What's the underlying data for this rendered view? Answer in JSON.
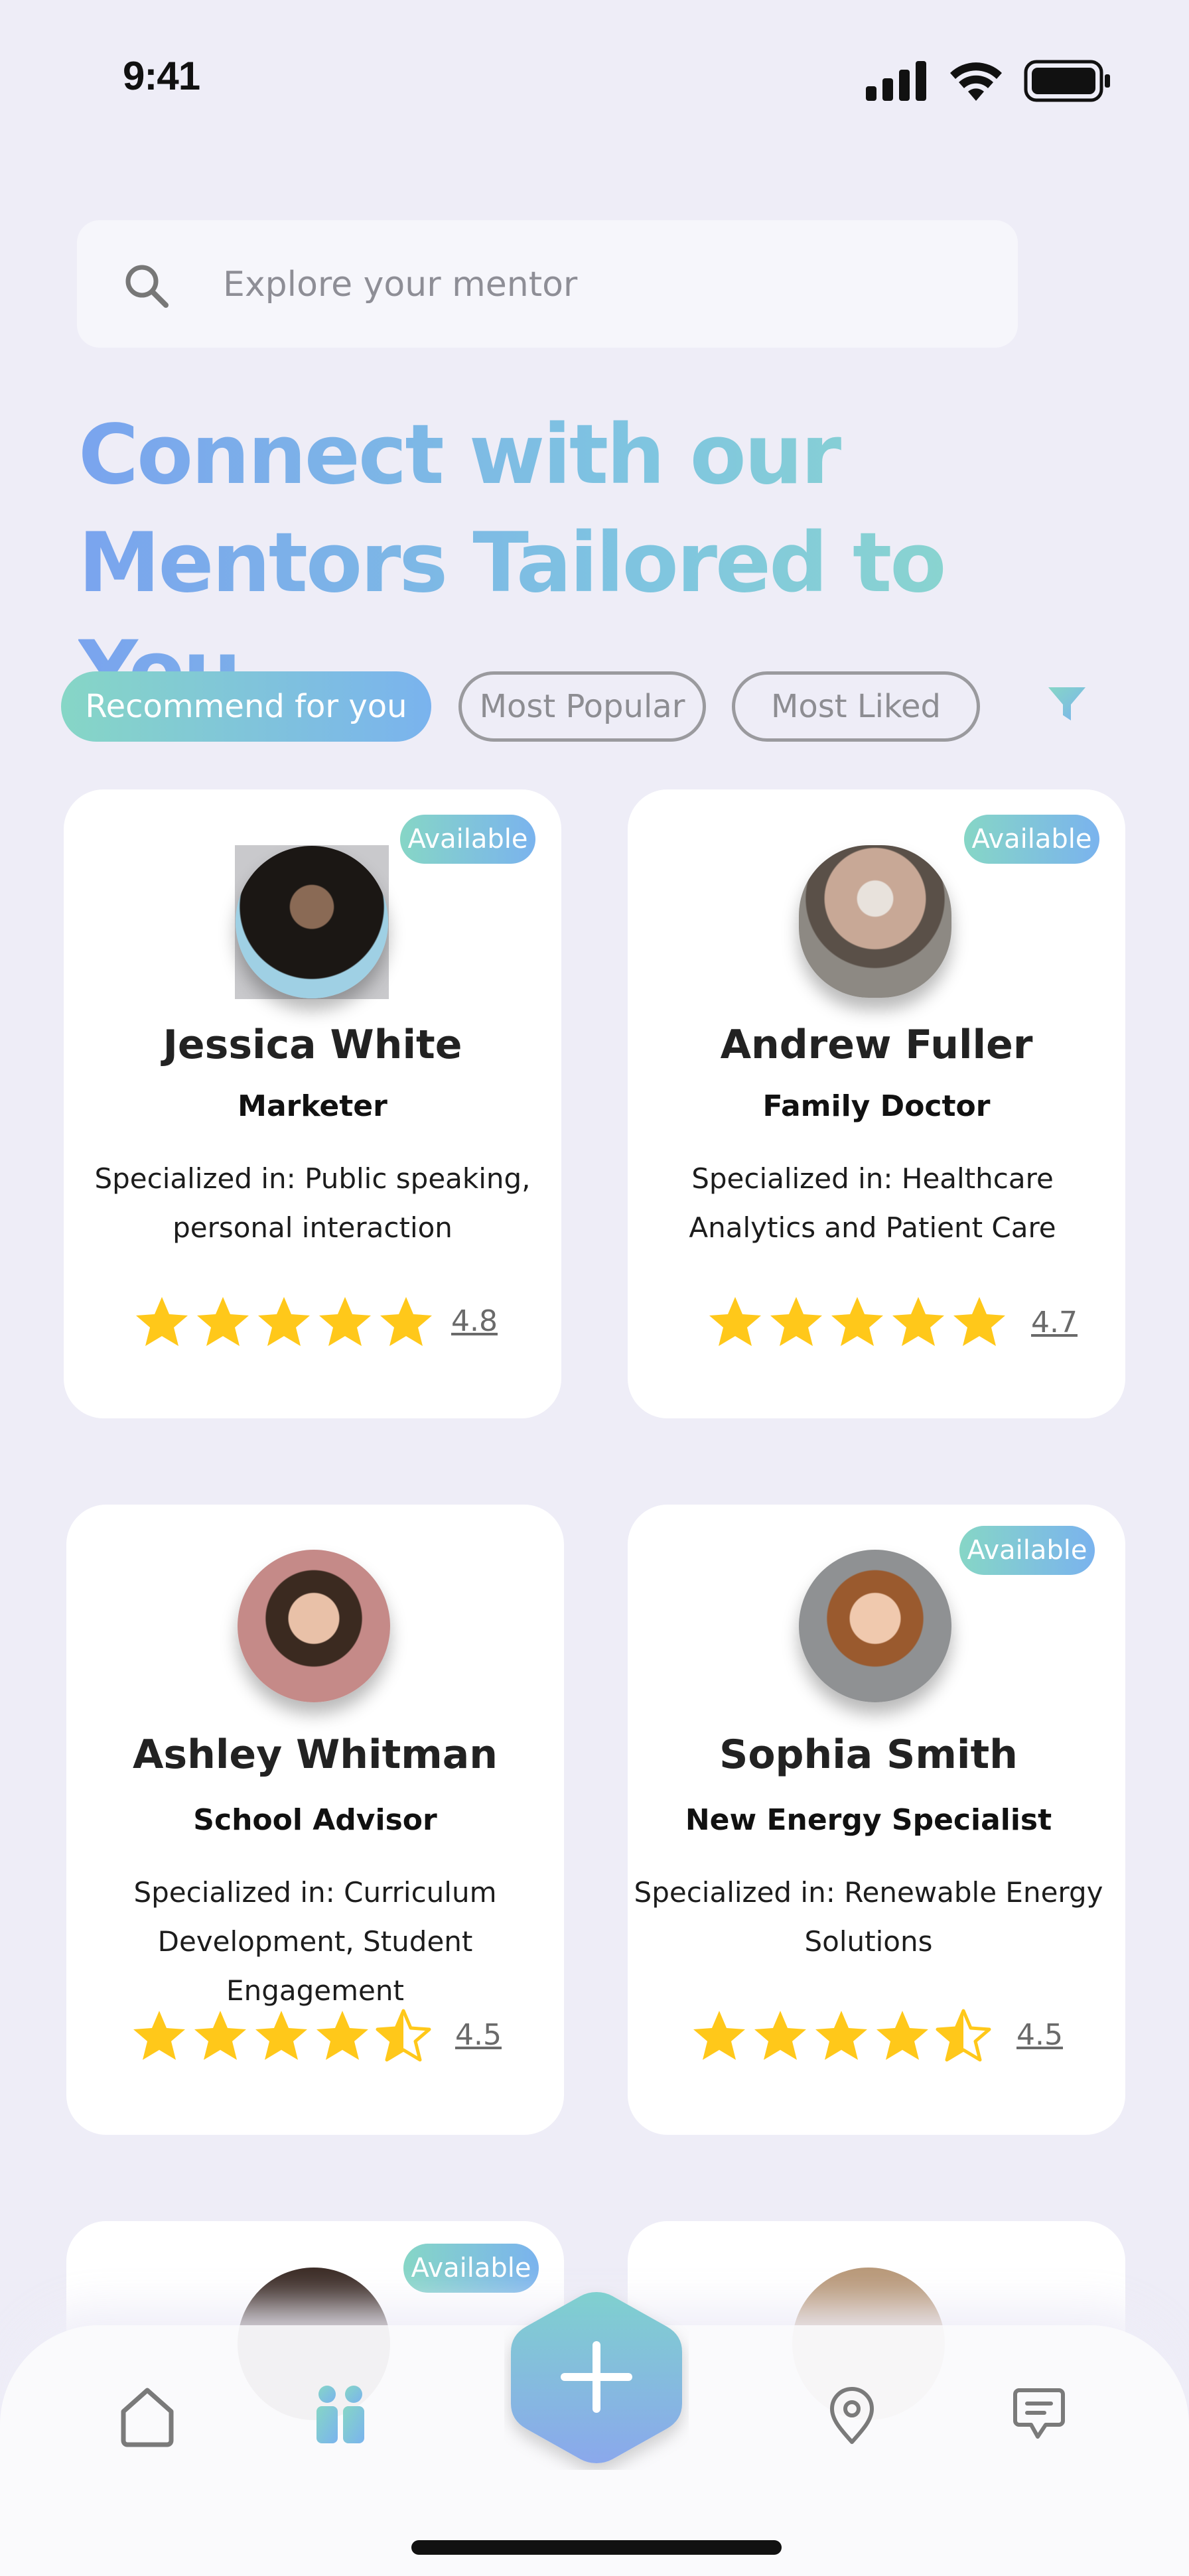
{
  "status_bar": {
    "time": "9:41"
  },
  "search": {
    "placeholder": "Explore your mentor"
  },
  "headline": {
    "line1": "Connect with our",
    "line2": "Mentors Tailored to You"
  },
  "filters": [
    {
      "label": "Recommend for you",
      "active": true
    },
    {
      "label": "Most Popular",
      "active": false
    },
    {
      "label": "Most Liked",
      "active": false
    }
  ],
  "mentors": [
    {
      "name": "Jessica White",
      "role": "Marketer",
      "spec_line1": "Specialized in: Public speaking,",
      "spec_line2": "personal interaction",
      "rating": "4.8",
      "available": "Available"
    },
    {
      "name": "Andrew Fuller",
      "role": "Family Doctor",
      "spec_line1": "Specialized in: Healthcare",
      "spec_line2": "Analytics and Patient Care",
      "rating": "4.7",
      "available": "Available"
    },
    {
      "name": "Ashley Whitman",
      "role": "School Advisor",
      "spec_line1": "Specialized in: Curriculum",
      "spec_line2": "Development, Student Engagement",
      "rating": "4.5",
      "available": ""
    },
    {
      "name": "Sophia Smith",
      "role": "New Energy Specialist",
      "spec_line1": "Specialized in: Renewable Energy",
      "spec_line2": "Solutions",
      "rating": "4.5",
      "available": "Available"
    }
  ],
  "partial_cards": {
    "left_badge": "Available"
  },
  "colors": {
    "accent_start": "#86d6c6",
    "accent_end": "#7ab3ee",
    "star": "#ffc81a",
    "background": "#eeedf7"
  },
  "icons": [
    "search-icon",
    "filter-icon",
    "home-icon",
    "mentors-icon",
    "add-icon",
    "location-icon",
    "chat-icon"
  ]
}
